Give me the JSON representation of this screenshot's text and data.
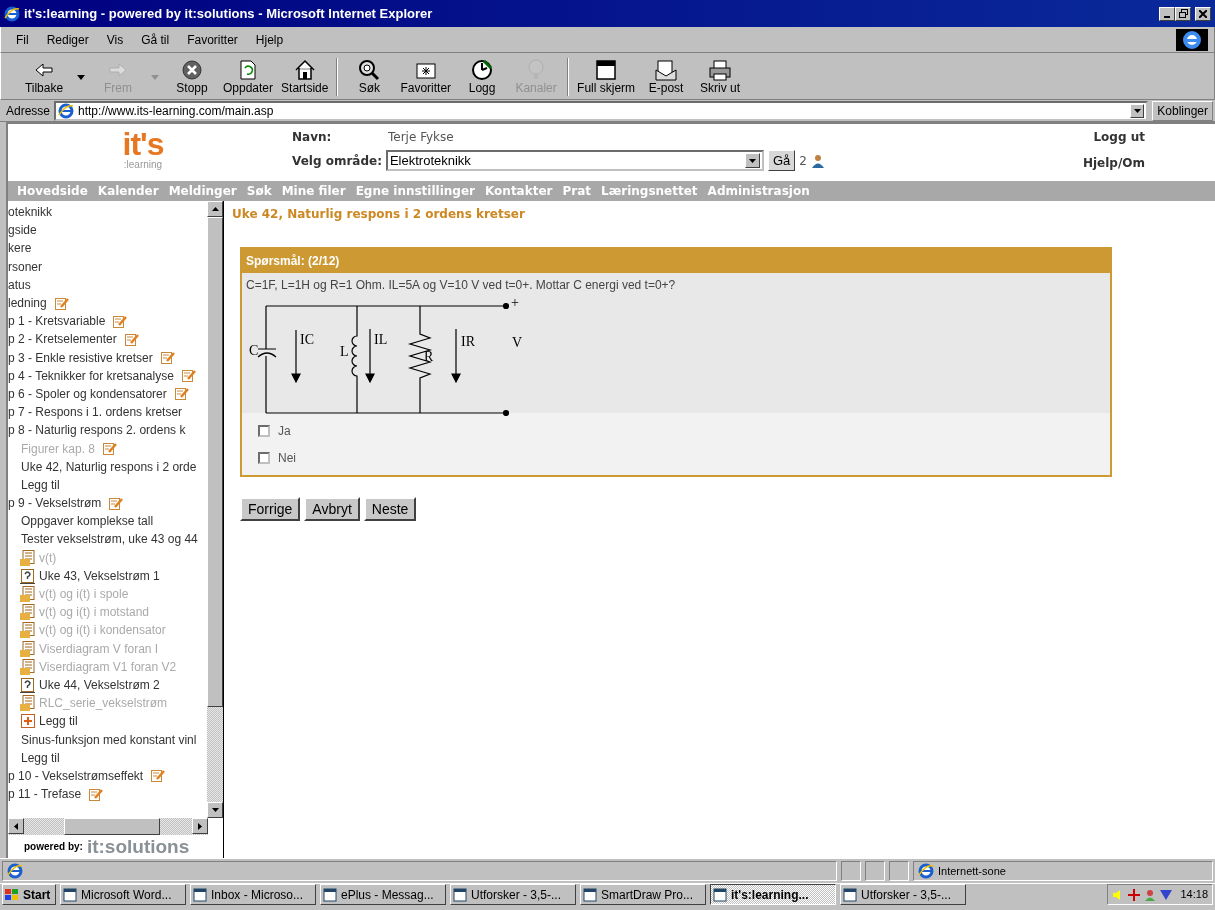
{
  "window": {
    "title": "it's:learning - powered by it:solutions - Microsoft Internet Explorer"
  },
  "menu": [
    "Fil",
    "Rediger",
    "Vis",
    "Gå til",
    "Favoritter",
    "Hjelp"
  ],
  "toolbar": [
    {
      "label": "Tilbake",
      "disabled": false,
      "dropdown": true
    },
    {
      "label": "Frem",
      "disabled": true,
      "dropdown": true
    },
    {
      "label": "Stopp",
      "disabled": false,
      "dropdown": false
    },
    {
      "label": "Oppdater",
      "disabled": false,
      "dropdown": false
    },
    {
      "label": "Startside",
      "disabled": false,
      "dropdown": false
    },
    {
      "label": "Søk",
      "disabled": false,
      "dropdown": false
    },
    {
      "label": "Favoritter",
      "disabled": false,
      "dropdown": false
    },
    {
      "label": "Logg",
      "disabled": false,
      "dropdown": false
    },
    {
      "label": "Kanaler",
      "disabled": true,
      "dropdown": false
    },
    {
      "label": "Full skjerm",
      "disabled": false,
      "dropdown": false
    },
    {
      "label": "E-post",
      "disabled": false,
      "dropdown": false
    },
    {
      "label": "Skriv ut",
      "disabled": false,
      "dropdown": false
    }
  ],
  "address": {
    "label": "Adresse",
    "url": "http://www.its-learning.com/main.asp",
    "links": "Koblinger"
  },
  "header": {
    "logo": "it's",
    "tagline": ":learning",
    "name_label": "Navn:",
    "name": "Terje Fykse",
    "area_label": "Velg område:",
    "area": "Elektroteknikk",
    "go": "Gå",
    "online": "2",
    "logout": "Logg ut",
    "help": "Hjelp/Om"
  },
  "nav": [
    "Hovedside",
    "Kalender",
    "Meldinger",
    "Søk",
    "Mine filer",
    "Egne innstillinger",
    "Kontakter",
    "Prat",
    "Læringsnettet",
    "Administrasjon"
  ],
  "sidebar": {
    "items": [
      {
        "kind": "text",
        "label": "oteknikk",
        "dimmed": false,
        "edit_icon": false
      },
      {
        "kind": "text",
        "label": "gside",
        "dimmed": false,
        "edit_icon": false
      },
      {
        "kind": "text",
        "label": "kere",
        "dimmed": false,
        "edit_icon": false
      },
      {
        "kind": "text",
        "label": "rsoner",
        "dimmed": false,
        "edit_icon": false
      },
      {
        "kind": "text",
        "label": "atus",
        "dimmed": false,
        "edit_icon": false
      },
      {
        "kind": "text",
        "label": "ledning",
        "dimmed": false,
        "edit_icon": true
      },
      {
        "kind": "text",
        "label": "p 1 - Kretsvariable",
        "dimmed": false,
        "edit_icon": true
      },
      {
        "kind": "text",
        "label": "p 2 - Kretselementer",
        "dimmed": false,
        "edit_icon": true
      },
      {
        "kind": "text",
        "label": "p 3 - Enkle resistive kretser",
        "dimmed": false,
        "edit_icon": true
      },
      {
        "kind": "text",
        "label": "p 4 - Teknikker for kretsanalyse",
        "dimmed": false,
        "edit_icon": true
      },
      {
        "kind": "text",
        "label": "p 6 - Spoler og kondensatorer",
        "dimmed": false,
        "edit_icon": true
      },
      {
        "kind": "text",
        "label": "p 7 - Respons i 1. ordens kretser",
        "dimmed": false,
        "edit_icon": false
      },
      {
        "kind": "text",
        "label": "p 8 - Naturlig respons 2. ordens k",
        "dimmed": false,
        "edit_icon": false,
        "children": [
          {
            "kind": "text",
            "label": "Figurer kap. 8",
            "dimmed": true,
            "edit_icon": true
          },
          {
            "kind": "text",
            "label": "Uke 42, Naturlig respons i 2 orde",
            "dimmed": false,
            "edit_icon": false
          },
          {
            "kind": "text",
            "label": "Legg til",
            "dimmed": false,
            "edit_icon": false
          }
        ]
      },
      {
        "kind": "text",
        "label": "p 9 - Vekselstrøm",
        "dimmed": false,
        "edit_icon": true,
        "children": [
          {
            "kind": "text",
            "label": "Oppgaver komplekse tall",
            "dimmed": false,
            "edit_icon": false
          },
          {
            "kind": "text",
            "label": "Tester vekselstrøm, uke 43 og 44",
            "dimmed": false,
            "edit_icon": false
          },
          {
            "kind": "document",
            "label": "v(t)",
            "dimmed": true,
            "edit_icon": false
          },
          {
            "kind": "quiz",
            "label": "Uke 43, Vekselstrøm 1",
            "dimmed": false,
            "edit_icon": false
          },
          {
            "kind": "document",
            "label": "v(t) og i(t) i spole",
            "dimmed": true,
            "edit_icon": false
          },
          {
            "kind": "document",
            "label": "v(t) og i(t) i motstand",
            "dimmed": true,
            "edit_icon": false
          },
          {
            "kind": "document",
            "label": "v(t) og i(t) i kondensator",
            "dimmed": true,
            "edit_icon": false
          },
          {
            "kind": "document",
            "label": "Viserdiagram V foran I",
            "dimmed": true,
            "edit_icon": false
          },
          {
            "kind": "document",
            "label": "Viserdiagram V1 foran V2",
            "dimmed": true,
            "edit_icon": false
          },
          {
            "kind": "quiz",
            "label": "Uke 44, Vekselstrøm 2",
            "dimmed": false,
            "edit_icon": false
          },
          {
            "kind": "document",
            "label": "RLC_serie_vekselstrøm",
            "dimmed": true,
            "edit_icon": false
          },
          {
            "kind": "add",
            "label": "Legg til",
            "dimmed": false,
            "edit_icon": false
          },
          {
            "kind": "text",
            "label": "Sinus-funksjon med konstant vinl",
            "dimmed": false,
            "edit_icon": false
          },
          {
            "kind": "text",
            "label": "Legg til",
            "dimmed": false,
            "edit_icon": false
          }
        ]
      },
      {
        "kind": "text",
        "label": "p 10 - Vekselstrømseffekt",
        "dimmed": false,
        "edit_icon": true
      },
      {
        "kind": "text",
        "label": "p 11 - Trefase",
        "dimmed": false,
        "edit_icon": true
      }
    ],
    "footer_label": "powered by:",
    "footer_brand": "it:solutions"
  },
  "content": {
    "title": "Uke 42, Naturlig respons i 2 ordens kretser",
    "question": {
      "header": "Spørsmål: (2/12)",
      "text": "C=1F, L=1H og R=1 Ohm. IL=5A og V=10 V ved t=0+. Mottar C energi ved t=0+?",
      "circuit": {
        "capacitor": "C",
        "current_c": "IC",
        "inductor": "L",
        "current_l": "IL",
        "resistor": "R",
        "current_r": "IR",
        "voltage": "V",
        "plus": "+"
      },
      "options": [
        {
          "label": "Ja",
          "checked": false
        },
        {
          "label": "Nei",
          "checked": false
        }
      ]
    },
    "buttons": [
      "Forrige",
      "Avbryt",
      "Neste"
    ]
  },
  "status_bar": {
    "zone": "Internett-sone"
  },
  "taskbar": {
    "start": "Start",
    "tasks": [
      {
        "label": "Microsoft Word...",
        "selected": false
      },
      {
        "label": "Inbox - Microso...",
        "selected": false
      },
      {
        "label": "ePlus - Messag...",
        "selected": false
      },
      {
        "label": "Utforsker - 3,5-...",
        "selected": false
      },
      {
        "label": "SmartDraw Pro...",
        "selected": false
      },
      {
        "label": "it's:learning...",
        "selected": true
      },
      {
        "label": "Utforsker - 3,5-...",
        "selected": false
      }
    ],
    "clock": "14:18"
  }
}
